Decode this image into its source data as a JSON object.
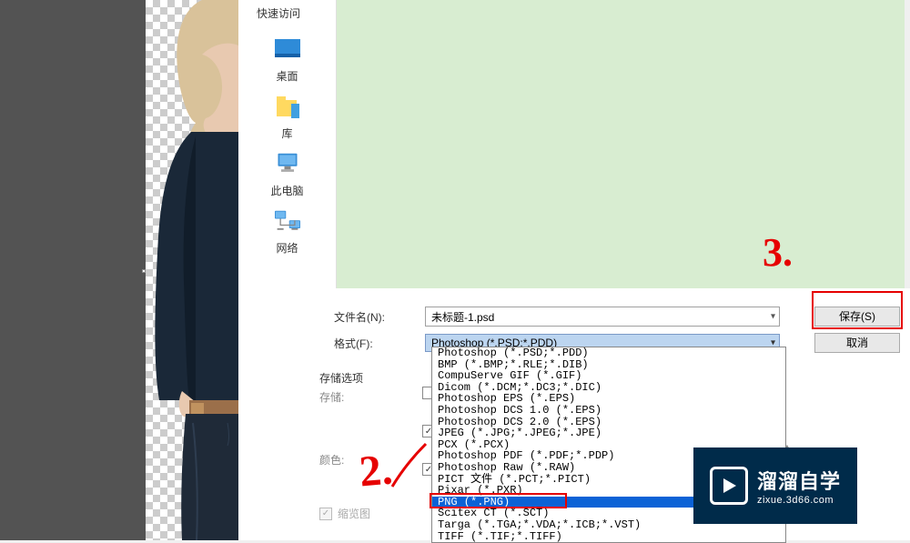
{
  "quick_access": {
    "title": "快速访问",
    "items": [
      {
        "label": "桌面",
        "icon": "desktop"
      },
      {
        "label": "库",
        "icon": "library"
      },
      {
        "label": "此电脑",
        "icon": "computer"
      },
      {
        "label": "网络",
        "icon": "network"
      }
    ]
  },
  "form": {
    "filename_label": "文件名(N):",
    "filename_value": "未标题-1.psd",
    "format_label": "格式(F):",
    "format_value": "Photoshop (*.PSD;*.PDD)"
  },
  "dropdown": {
    "items": [
      "Photoshop (*.PSD;*.PDD)",
      "BMP (*.BMP;*.RLE;*.DIB)",
      "CompuServe GIF (*.GIF)",
      "Dicom (*.DCM;*.DC3;*.DIC)",
      "Photoshop EPS (*.EPS)",
      "Photoshop DCS 1.0 (*.EPS)",
      "Photoshop DCS 2.0 (*.EPS)",
      "JPEG (*.JPG;*.JPEG;*.JPE)",
      "PCX (*.PCX)",
      "Photoshop PDF (*.PDF;*.PDP)",
      "Photoshop Raw (*.RAW)",
      "PICT 文件 (*.PCT;*.PICT)",
      "Pixar (*.PXR)",
      "PNG (*.PNG)",
      "Scitex CT (*.SCT)",
      "Targa (*.TGA;*.VDA;*.ICB;*.VST)",
      "TIFF (*.TIF;*.TIFF)"
    ],
    "selected_index": 13
  },
  "buttons": {
    "save": "保存(S)",
    "cancel": "取消"
  },
  "storage": {
    "title": "存储选项",
    "save_label": "存储:",
    "color_label": "颜色:",
    "thumbnail_label": "缩览图"
  },
  "annotations": {
    "num2": "2.",
    "num3": "3."
  },
  "watermark": {
    "title": "溜溜自学",
    "sub": "zixue.3d66.com"
  }
}
